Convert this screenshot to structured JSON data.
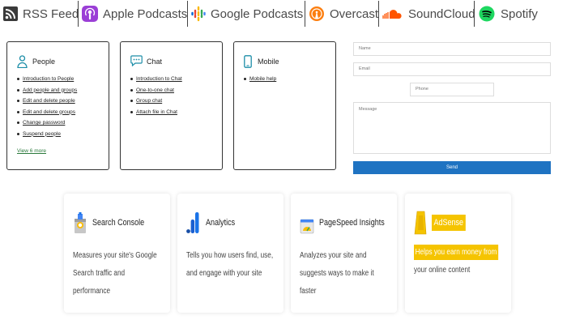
{
  "podcasts": [
    {
      "label": "RSS Feed",
      "icon": "rss-icon"
    },
    {
      "label": "Apple Podcasts",
      "icon": "apple-podcasts-icon"
    },
    {
      "label": "Google Podcasts",
      "icon": "google-podcasts-icon"
    },
    {
      "label": "Overcast",
      "icon": "overcast-icon"
    },
    {
      "label": "SoundCloud",
      "icon": "soundcloud-icon"
    },
    {
      "label": "Spotify",
      "icon": "spotify-icon"
    }
  ],
  "help": {
    "people": {
      "title": "People",
      "links": [
        "Introduction to People",
        "Add people and groups",
        "Edit and delete people",
        "Edit and delete groups",
        "Change password",
        "Suspend people"
      ],
      "more": "View 6 more"
    },
    "chat": {
      "title": "Chat",
      "links": [
        "Introduction to Chat",
        "One-to-one chat",
        "Group chat",
        "Attach file in Chat"
      ]
    },
    "mobile": {
      "title": "Mobile",
      "links": [
        "Mobile help"
      ]
    }
  },
  "form": {
    "name_placeholder": "Name",
    "email_placeholder": "Email",
    "phone_placeholder": "Phone",
    "message_placeholder": "Message",
    "send_label": "Send"
  },
  "tools": [
    {
      "title": "Search Console",
      "desc": "Measures your site's Google Search traffic and performance"
    },
    {
      "title": "Analytics",
      "desc": "Tells you how users find, use, and engage with your site"
    },
    {
      "title": "PageSpeed Insights",
      "desc": "Analyzes your site and suggests ways to make it faster"
    },
    {
      "title": "AdSense",
      "desc_highlight": "Helps you earn money from",
      "desc_rest": "your online content"
    }
  ],
  "colors": {
    "send_button": "#1f73c2",
    "adsense_highlight": "#f5c400",
    "view_more": "#2b7a3c"
  }
}
